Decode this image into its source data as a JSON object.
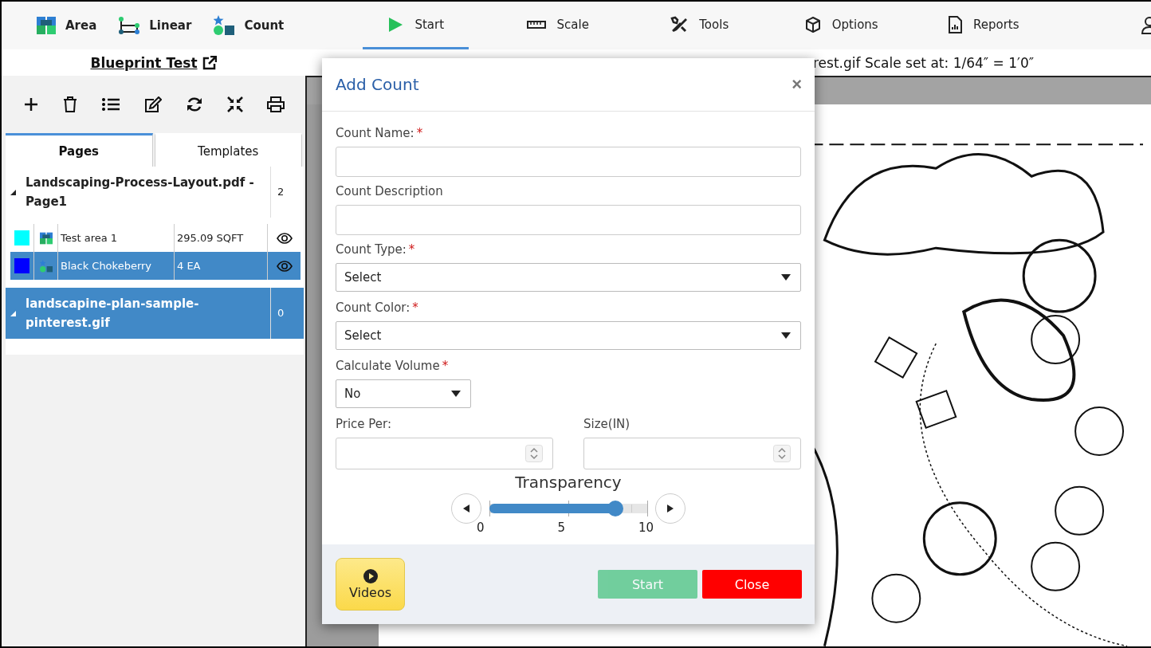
{
  "toolbar": {
    "tools": [
      {
        "label": "Area",
        "kind": "area"
      },
      {
        "label": "Linear",
        "kind": "linear"
      },
      {
        "label": "Count",
        "kind": "count"
      }
    ],
    "tabs": [
      {
        "label": "Start",
        "kind": "play",
        "selected": true
      },
      {
        "label": "Scale",
        "kind": "ruler",
        "selected": false
      },
      {
        "label": "Tools",
        "kind": "tools",
        "selected": false
      },
      {
        "label": "Options",
        "kind": "cube",
        "selected": false
      },
      {
        "label": "Reports",
        "kind": "report",
        "selected": false
      }
    ]
  },
  "project": {
    "title": "Blueprint Test"
  },
  "scale_info": "rest.gif Scale set at: 1/64″ = 1′0″",
  "sidebar": {
    "actions": [
      {
        "kind": "add"
      },
      {
        "kind": "delete"
      },
      {
        "kind": "list"
      },
      {
        "kind": "edit"
      },
      {
        "kind": "refresh"
      },
      {
        "kind": "collapse"
      },
      {
        "kind": "print"
      }
    ],
    "tabs": [
      {
        "label": "Pages",
        "selected": true
      },
      {
        "label": "Templates",
        "selected": false
      }
    ],
    "pages": [
      {
        "name": "Landscaping-Process-Layout.pdf - Page1",
        "count": "2",
        "selected": false,
        "children": [
          {
            "name": "Test area 1",
            "kind": "area",
            "color": "#00ffff",
            "measure": "295.09 SQFT",
            "selected": false
          },
          {
            "name": "Black Chokeberry",
            "kind": "count",
            "color": "#0000ff",
            "measure": "4 EA",
            "selected": true
          }
        ]
      },
      {
        "name": "landscapine-plan-sample-pinterest.gif",
        "count": "0",
        "selected": true
      }
    ]
  },
  "dialog": {
    "title": "Add Count",
    "close": "×",
    "fields": [
      {
        "label": "Count Name:",
        "required_mark": "*",
        "kind": "text"
      },
      {
        "label": "Count Description",
        "kind": "text"
      },
      {
        "label": "Count Type:",
        "required_mark": "*",
        "kind": "select",
        "value": "Select"
      },
      {
        "label": "Count Color:",
        "required_mark": "*",
        "kind": "select",
        "value": "Select"
      },
      {
        "label": "Calculate Volume",
        "required_mark": "*",
        "kind": "small-select",
        "value": "No"
      }
    ],
    "number_fields": [
      {
        "label": "Price Per:"
      },
      {
        "label": "Size(IN)"
      }
    ],
    "transparency": {
      "label": "Transparency",
      "level": 0.8,
      "ticks": [
        "0",
        "5",
        "10"
      ]
    },
    "buttons": [
      {
        "label": "Videos",
        "kind": "videos"
      },
      {
        "label": "Start",
        "kind": "start",
        "disabled": true
      },
      {
        "label": "Close",
        "kind": "close"
      }
    ]
  }
}
